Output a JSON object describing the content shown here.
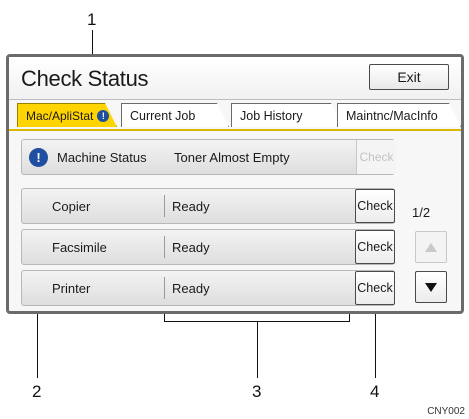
{
  "callouts": [
    "1",
    "2",
    "3",
    "4"
  ],
  "window": {
    "title": "Check Status",
    "exit_label": "Exit"
  },
  "tabs": [
    {
      "label": "Mac/ApliStat",
      "alert_icon": "info-alert-icon",
      "alert_glyph": "!",
      "active": true
    },
    {
      "label": "Current Job"
    },
    {
      "label": "Job History"
    },
    {
      "label": "Maintnc/MacInfo"
    }
  ],
  "machine_status": {
    "icon": "info-alert-icon",
    "icon_glyph": "!",
    "label": "Machine Status",
    "text": "Toner Almost Empty",
    "check_label": "Check"
  },
  "functions": [
    {
      "name": "Copier",
      "status": "Ready",
      "check_label": "Check"
    },
    {
      "name": "Facsimile",
      "status": "Ready",
      "check_label": "Check"
    },
    {
      "name": "Printer",
      "status": "Ready",
      "check_label": "Check"
    }
  ],
  "pagination": {
    "indicator": "1/2"
  },
  "figure_code": "CNY002",
  "colors": {
    "active_tab": "#ffd400",
    "alert_icon": "#1f4fa0",
    "panel_border": "#6b6b6b"
  }
}
